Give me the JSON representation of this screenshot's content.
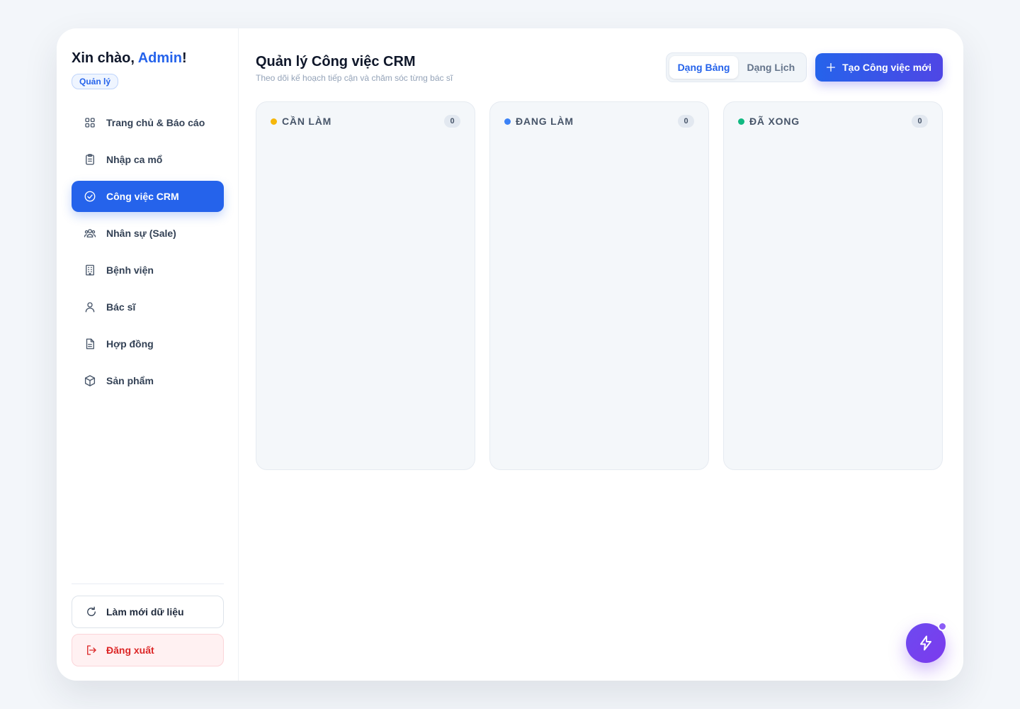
{
  "sidebar": {
    "greeting_prefix": "Xin chào, ",
    "user_name": "Admin",
    "greeting_suffix": "!",
    "role": "Quản lý",
    "items": [
      {
        "label": "Trang chủ & Báo cáo",
        "icon": "grid-icon"
      },
      {
        "label": "Nhập ca mổ",
        "icon": "clipboard-icon"
      },
      {
        "label": "Công việc CRM",
        "icon": "check-circle-icon",
        "active": true
      },
      {
        "label": "Nhân sự (Sale)",
        "icon": "users-icon"
      },
      {
        "label": "Bệnh viện",
        "icon": "building-icon"
      },
      {
        "label": "Bác sĩ",
        "icon": "user-icon"
      },
      {
        "label": "Hợp đồng",
        "icon": "document-icon"
      },
      {
        "label": "Sản phẩm",
        "icon": "box-icon"
      }
    ],
    "refresh_label": "Làm mới dữ liệu",
    "logout_label": "Đăng xuất"
  },
  "main": {
    "title": "Quản lý Công việc CRM",
    "subtitle": "Theo dõi kế hoạch tiếp cận và chăm sóc từng bác sĩ",
    "view_toggle": {
      "board": "Dạng Bảng",
      "calendar": "Dạng Lịch",
      "active": "board"
    },
    "create_label": "Tạo Công việc mới",
    "columns": [
      {
        "title": "CẦN LÀM",
        "count": "0",
        "color": "#f5b70b"
      },
      {
        "title": "ĐANG LÀM",
        "count": "0",
        "color": "#3b82f6"
      },
      {
        "title": "ĐÃ XONG",
        "count": "0",
        "color": "#10b981"
      }
    ]
  },
  "colors": {
    "accent": "#2563eb",
    "fab": "#7c3aed",
    "danger": "#dc2626"
  },
  "fab_icon": "lightning-icon"
}
